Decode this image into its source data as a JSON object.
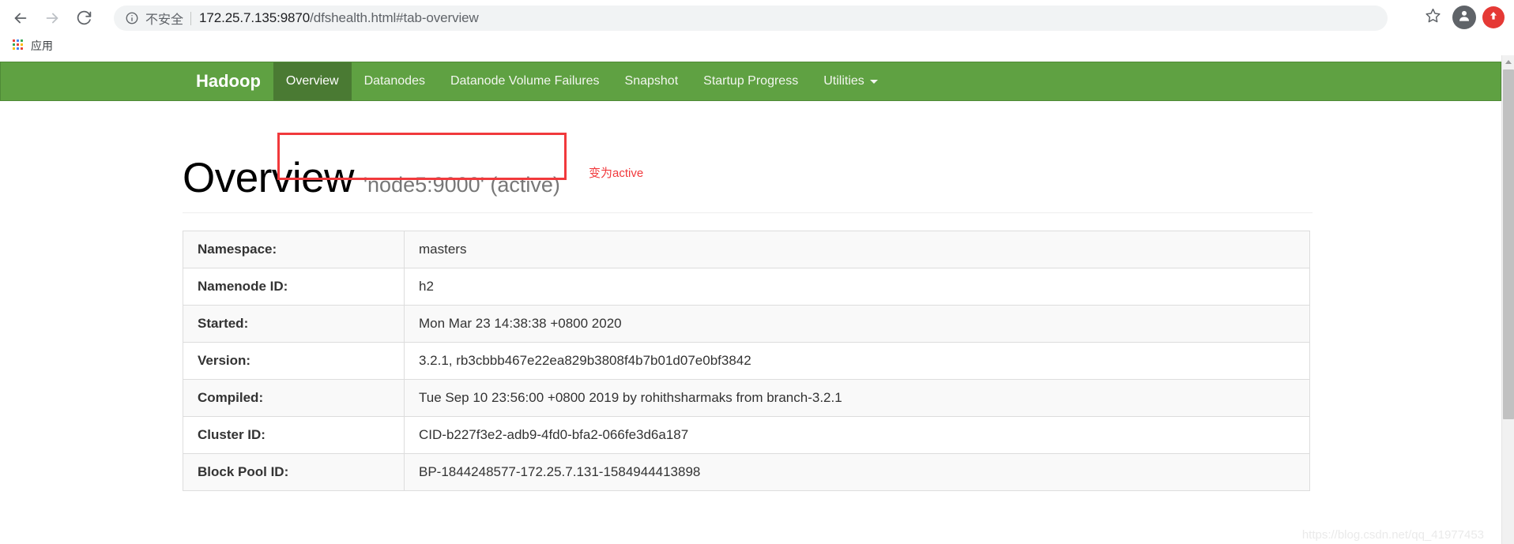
{
  "browser": {
    "back_icon": "back-arrow-icon",
    "forward_icon": "forward-arrow-icon",
    "reload_icon": "reload-icon",
    "security_label": "不安全",
    "security_icon": "info-circle-icon",
    "url": "172.25.7.135:9870/dfshealth.html#tab-overview",
    "url_host": "172.25.7.135:9870",
    "url_path": "/dfshealth.html#tab-overview",
    "star_icon": "star-icon",
    "profile_icon": "profile-avatar-icon",
    "update_icon": "update-arrow-icon",
    "bookmarks": {
      "apps_icon": "apps-grid-icon",
      "apps_label": "应用"
    }
  },
  "navbar": {
    "brand": "Hadoop",
    "items": [
      {
        "label": "Overview",
        "active": true
      },
      {
        "label": "Datanodes",
        "active": false
      },
      {
        "label": "Datanode Volume Failures",
        "active": false
      },
      {
        "label": "Snapshot",
        "active": false
      },
      {
        "label": "Startup Progress",
        "active": false
      },
      {
        "label": "Utilities",
        "active": false,
        "dropdown": true
      }
    ],
    "background_color": "#5fa142",
    "active_color": "#4a7a33"
  },
  "page": {
    "title": "Overview",
    "subtitle": "'node5:9000' (active)",
    "annotation": "变为active",
    "annotation_color": "#f1393c",
    "highlight_color": "#f1393c"
  },
  "info_table": {
    "rows": [
      {
        "key": "Namespace:",
        "value": "masters"
      },
      {
        "key": "Namenode ID:",
        "value": "h2"
      },
      {
        "key": "Started:",
        "value": "Mon Mar 23 14:38:38 +0800 2020"
      },
      {
        "key": "Version:",
        "value": "3.2.1, rb3cbbb467e22ea829b3808f4b7b01d07e0bf3842"
      },
      {
        "key": "Compiled:",
        "value": "Tue Sep 10 23:56:00 +0800 2019 by rohithsharmaks from branch-3.2.1"
      },
      {
        "key": "Cluster ID:",
        "value": "CID-b227f3e2-adb9-4fd0-bfa2-066fe3d6a187"
      },
      {
        "key": "Block Pool ID:",
        "value": "BP-1844248577-172.25.7.131-1584944413898"
      }
    ]
  },
  "watermark": "https://blog.csdn.net/qq_41977453"
}
